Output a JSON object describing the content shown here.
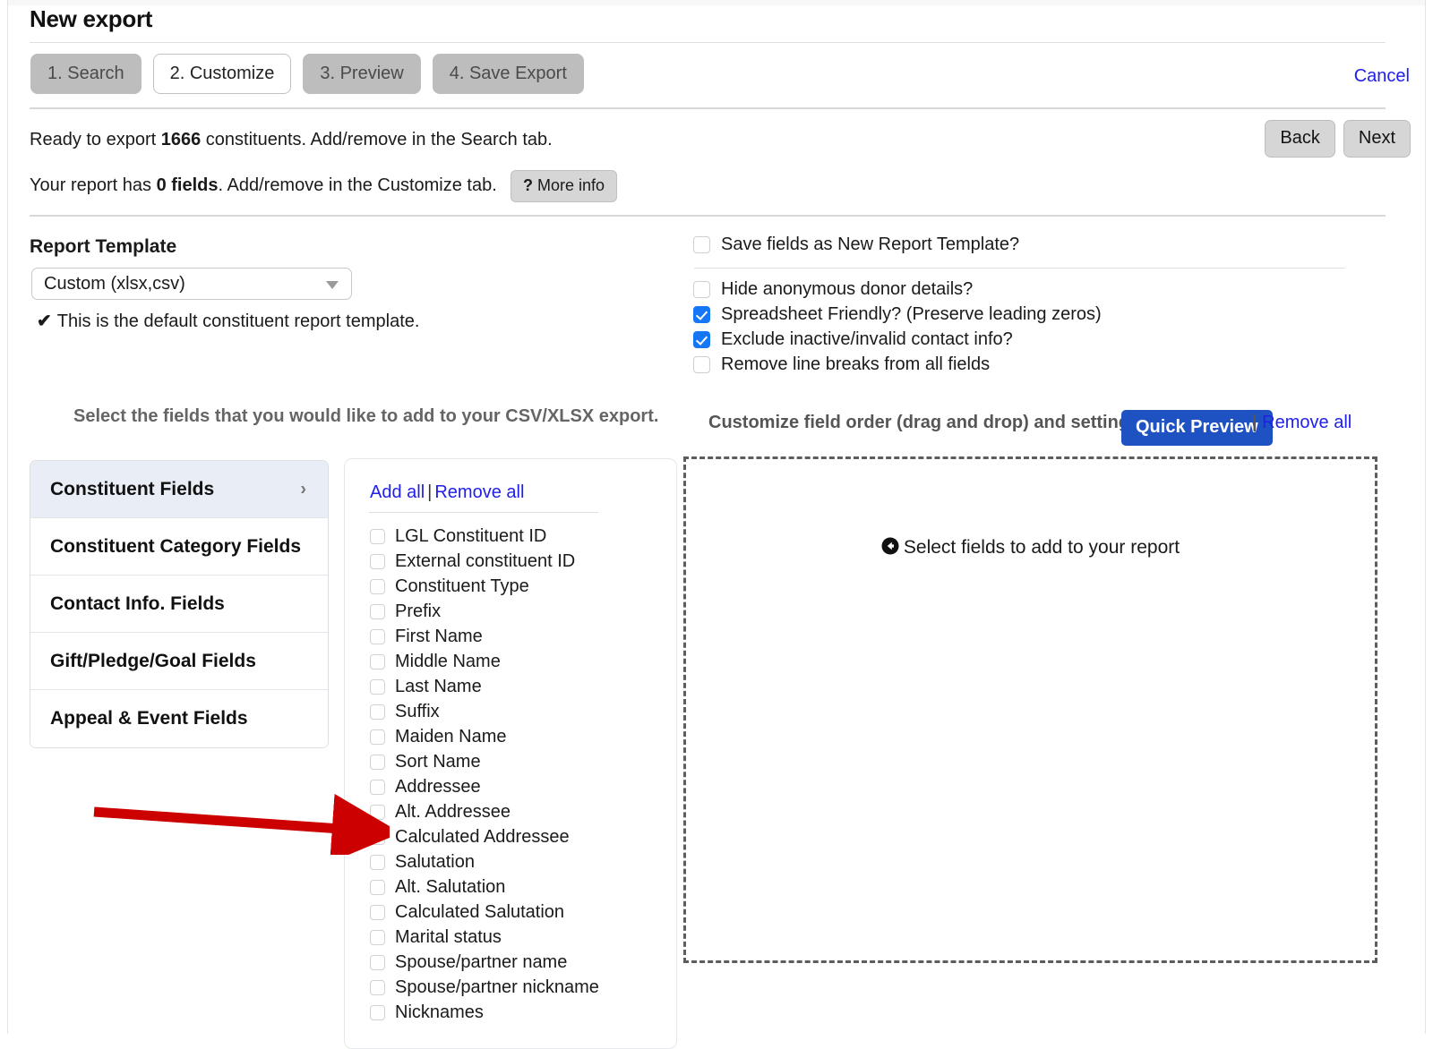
{
  "header": {
    "title": "New export",
    "cancel_label": "Cancel",
    "tabs": [
      {
        "label": "1. Search",
        "active": false
      },
      {
        "label": "2. Customize",
        "active": true
      },
      {
        "label": "3. Preview",
        "active": false
      },
      {
        "label": "4. Save Export",
        "active": false
      }
    ]
  },
  "status": {
    "line1_pre": "Ready to export ",
    "line1_count": "1666",
    "line1_post": " constituents. Add/remove in the Search tab.",
    "line2_pre": "Your report has ",
    "line2_count": "0 fields",
    "line2_post": ". Add/remove in the Customize tab.",
    "more_info_q": "?",
    "more_info_label": "More info",
    "back_label": "Back",
    "next_label": "Next"
  },
  "report_template": {
    "section_title": "Report Template",
    "selected_value": "Custom (xlsx,csv)",
    "check_glyph": "✔",
    "default_note": "This is the default constituent report template."
  },
  "options": {
    "save_template": {
      "label": "Save fields as New Report Template?",
      "checked": false
    },
    "items": [
      {
        "label": "Hide anonymous donor details?",
        "checked": false
      },
      {
        "label": "Spreadsheet Friendly? (Preserve leading zeros)",
        "checked": true
      },
      {
        "label": "Exclude inactive/invalid contact info?",
        "checked": true
      },
      {
        "label": "Remove line breaks from all fields",
        "checked": false
      }
    ]
  },
  "helpers": {
    "left": "Select the fields that you would like to add to your CSV/XLSX export.",
    "right": "Customize field order (drag and drop) and settings.",
    "quick_preview_label": "Quick Preview",
    "pipe": "|",
    "remove_all_label": "Remove all"
  },
  "categories": [
    {
      "label": "Constituent Fields",
      "selected": true,
      "chevron": "›"
    },
    {
      "label": "Constituent Category Fields",
      "selected": false,
      "chevron": ""
    },
    {
      "label": "Contact Info. Fields",
      "selected": false,
      "chevron": ""
    },
    {
      "label": "Gift/Pledge/Goal Fields",
      "selected": false,
      "chevron": ""
    },
    {
      "label": "Appeal & Event Fields",
      "selected": false,
      "chevron": ""
    }
  ],
  "field_panel": {
    "add_all_label": "Add all",
    "separator": "|",
    "remove_all_label": "Remove all",
    "fields": [
      {
        "label": "LGL Constituent ID",
        "checked": false
      },
      {
        "label": "External constituent ID",
        "checked": false
      },
      {
        "label": "Constituent Type",
        "checked": false
      },
      {
        "label": "Prefix",
        "checked": false
      },
      {
        "label": "First Name",
        "checked": false
      },
      {
        "label": "Middle Name",
        "checked": false
      },
      {
        "label": "Last Name",
        "checked": false
      },
      {
        "label": "Suffix",
        "checked": false
      },
      {
        "label": "Maiden Name",
        "checked": false
      },
      {
        "label": "Sort Name",
        "checked": false
      },
      {
        "label": "Addressee",
        "checked": false
      },
      {
        "label": "Alt. Addressee",
        "checked": false
      },
      {
        "label": "Calculated Addressee",
        "checked": false
      },
      {
        "label": "Salutation",
        "checked": false
      },
      {
        "label": "Alt. Salutation",
        "checked": false
      },
      {
        "label": "Calculated Salutation",
        "checked": false
      },
      {
        "label": "Marital status",
        "checked": false
      },
      {
        "label": "Spouse/partner name",
        "checked": false
      },
      {
        "label": "Spouse/partner nickname",
        "checked": false
      },
      {
        "label": "Nicknames",
        "checked": false
      }
    ]
  },
  "dropzone": {
    "text": "Select fields to add to your report"
  },
  "annotation": {
    "arrow_color": "#cc0000"
  }
}
